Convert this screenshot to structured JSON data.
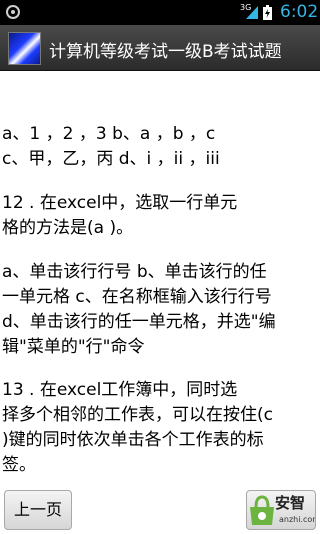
{
  "status_bar": {
    "network": "3G",
    "time": "6:02",
    "icons": [
      "notification-icon",
      "signal-icon",
      "battery-icon"
    ]
  },
  "title_bar": {
    "title": "计算机等级考试一级B考试试题",
    "icon": "app-icon"
  },
  "content": {
    "lines": [
      "a、1 ，2 ，3  b、a ，b ，c",
      "c、甲，乙，丙  d、i ，ii ，iii",
      "",
      "         12 . 在excel中，选取一行单元",
      "格的方法是(a )。",
      "",
      "a、单击该行行号 b、单击该行的任",
      "一单元格 c、在名称框输入该行行号",
      "d、单击该行的任一单元格，并选\"编",
      "辑\"菜单的\"行\"命令",
      "",
      "         13 . 在excel工作簿中，同时选",
      "择多个相邻的工作表，可以在按住(c",
      ")键的同时依次单击各个工作表的标",
      "签。"
    ]
  },
  "buttons": {
    "prev_label": "上一页",
    "watermark_text": "安智",
    "watermark_sub": "anzhi.com"
  },
  "colors": {
    "status_accent": "#33b5e5",
    "titlebar_bg": "#3a3a3a"
  }
}
